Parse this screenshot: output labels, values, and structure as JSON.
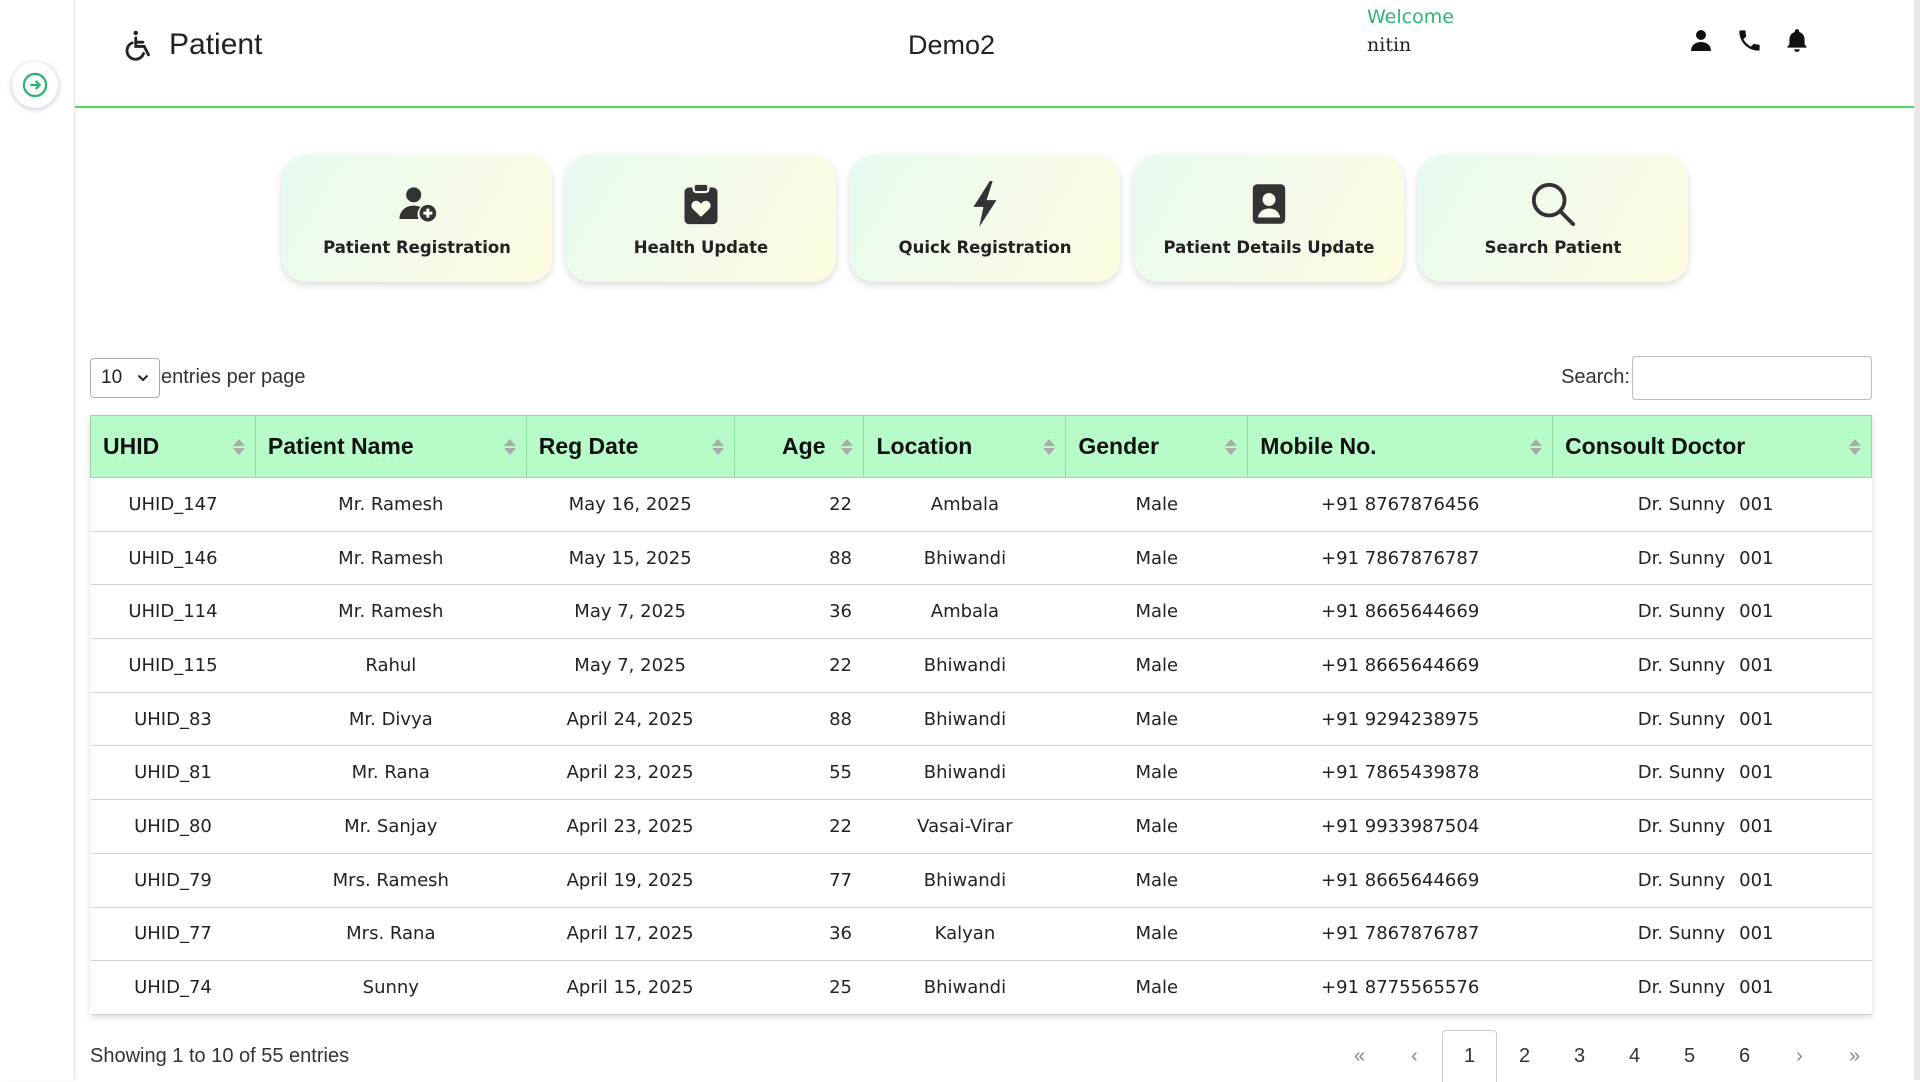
{
  "header": {
    "brand_title": "Patient",
    "org_name": "Demo2",
    "welcome_label": "Welcome",
    "user_name": "nitin",
    "icons": [
      "user-icon",
      "phone-icon",
      "bell-icon"
    ]
  },
  "sidebar": {
    "toggle_icon": "arrow-right-circle-icon"
  },
  "tiles": [
    {
      "label": "Patient Registration",
      "icon": "user-plus-icon"
    },
    {
      "label": "Health Update",
      "icon": "clipboard-heart-icon"
    },
    {
      "label": "Quick Registration",
      "icon": "lightning-icon"
    },
    {
      "label": "Patient Details Update",
      "icon": "contact-card-icon"
    },
    {
      "label": "Search Patient",
      "icon": "search-icon"
    }
  ],
  "controls": {
    "per_page_value": "10",
    "per_page_label": "entries per page",
    "search_label": "Search:",
    "search_value": ""
  },
  "table": {
    "columns": [
      "UHID",
      "Patient Name",
      "Reg Date",
      "Age",
      "Location",
      "Gender",
      "Mobile No.",
      "Consoult Doctor"
    ],
    "rows": [
      [
        "UHID_147",
        "Mr. Ramesh",
        "May 16, 2025",
        "22",
        "Ambala",
        "Male",
        "+91 8767876456",
        "Dr. Sunny",
        "001"
      ],
      [
        "UHID_146",
        "Mr. Ramesh",
        "May 15, 2025",
        "88",
        "Bhiwandi",
        "Male",
        "+91 7867876787",
        "Dr. Sunny",
        "001"
      ],
      [
        "UHID_114",
        "Mr. Ramesh",
        "May 7, 2025",
        "36",
        "Ambala",
        "Male",
        "+91 8665644669",
        "Dr. Sunny",
        "001"
      ],
      [
        "UHID_115",
        "Rahul",
        "May 7, 2025",
        "22",
        "Bhiwandi",
        "Male",
        "+91 8665644669",
        "Dr. Sunny",
        "001"
      ],
      [
        "UHID_83",
        "Mr. Divya",
        "April 24, 2025",
        "88",
        "Bhiwandi",
        "Male",
        "+91 9294238975",
        "Dr. Sunny",
        "001"
      ],
      [
        "UHID_81",
        "Mr. Rana",
        "April 23, 2025",
        "55",
        "Bhiwandi",
        "Male",
        "+91 7865439878",
        "Dr. Sunny",
        "001"
      ],
      [
        "UHID_80",
        "Mr. Sanjay",
        "April 23, 2025",
        "22",
        "Vasai-Virar",
        "Male",
        "+91 9933987504",
        "Dr. Sunny",
        "001"
      ],
      [
        "UHID_79",
        "Mrs. Ramesh",
        "April 19, 2025",
        "77",
        "Bhiwandi",
        "Male",
        "+91 8665644669",
        "Dr. Sunny",
        "001"
      ],
      [
        "UHID_77",
        "Mrs. Rana",
        "April 17, 2025",
        "36",
        "Kalyan",
        "Male",
        "+91 7867876787",
        "Dr. Sunny",
        "001"
      ],
      [
        "UHID_74",
        "Sunny",
        "April 15, 2025",
        "25",
        "Bhiwandi",
        "Male",
        "+91 8775565576",
        "Dr. Sunny",
        "001"
      ]
    ]
  },
  "footer": {
    "info": "Showing 1 to 10 of 55 entries",
    "pages": [
      "«",
      "‹",
      "1",
      "2",
      "3",
      "4",
      "5",
      "6",
      "›",
      "»"
    ],
    "active_page": "1"
  },
  "colors": {
    "accent_green": "#4cd964",
    "header_row": "#b7fcc8",
    "welcome": "#2bb673"
  }
}
